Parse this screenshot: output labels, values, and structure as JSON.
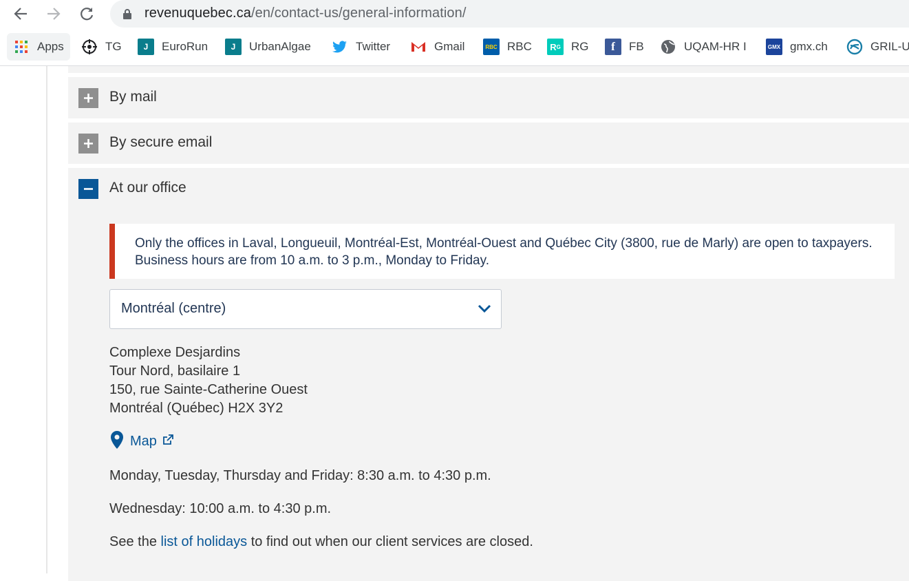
{
  "browser": {
    "url_host": "revenuquebec.ca",
    "url_path": "/en/contact-us/general-information/",
    "bookmarks": [
      {
        "label": "Apps",
        "icon": "apps-grid-icon"
      },
      {
        "label": "TG",
        "icon": "crosshair-icon"
      },
      {
        "label": "EuroRun",
        "icon": "j-icon",
        "color": "#0a7d8c"
      },
      {
        "label": "UrbanAlgae",
        "icon": "j-icon",
        "color": "#0a7d8c"
      },
      {
        "label": "Twitter",
        "icon": "twitter-icon",
        "color": "#1da1f2"
      },
      {
        "label": "Gmail",
        "icon": "gmail-icon",
        "color": "#d93025"
      },
      {
        "label": "RBC",
        "icon": "rbc-icon",
        "color": "#005daa"
      },
      {
        "label": "RG",
        "icon": "researchgate-icon",
        "color": "#00ccbb"
      },
      {
        "label": "FB",
        "icon": "facebook-icon",
        "color": "#3b5998"
      },
      {
        "label": "UQAM-HR I",
        "icon": "globe-icon",
        "color": "#5f6368"
      },
      {
        "label": "gmx.ch",
        "icon": "gmx-icon",
        "color": "#1c449b"
      },
      {
        "label": "GRIL-U",
        "icon": "gril-icon",
        "color": "#1a7fa8"
      }
    ]
  },
  "accordion": {
    "mail_label": "By mail",
    "secure_email_label": "By secure email",
    "office_label": "At our office"
  },
  "office": {
    "notice": "Only the offices in Laval, Longueuil, Montréal-Est, Montréal-Ouest and Québec City (3800, rue de Marly) are open to taxpayers. Business hours are from 10 a.m. to 3 p.m., Monday to Friday.",
    "selected_office": "Montréal (centre)",
    "address": [
      "Complexe Desjardins",
      "Tour Nord, basilaire 1",
      "150, rue Sainte-Catherine Ouest",
      "Montréal (Québec)  H2X 3Y2"
    ],
    "map_label": "Map",
    "hours_1": "Monday, Tuesday, Thursday and Friday: 8:30 a.m. to 4:30 p.m.",
    "hours_2": "Wednesday: 10:00 a.m. to 4:30 p.m.",
    "holidays_prefix": "See the ",
    "holidays_link": "list of holidays",
    "holidays_suffix": " to find out when our client services are closed."
  },
  "colors": {
    "accent": "#095797",
    "alert": "#cb381f",
    "panel": "#f3f3f3"
  }
}
